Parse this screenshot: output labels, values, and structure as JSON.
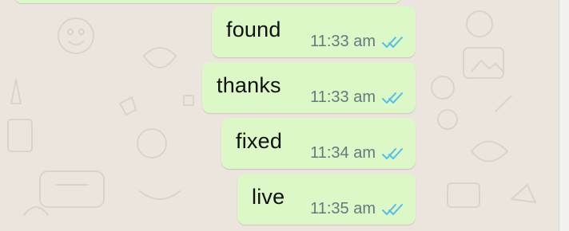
{
  "colors": {
    "wallpaper": "#ece5dd",
    "bubble_outgoing": "#dcf8c6",
    "read_ticks": "#53bdeb",
    "timestamp": "#667781"
  },
  "messages": [
    {
      "text": "found",
      "time": "11:33 am",
      "status": "read",
      "status_icon": "double-check-icon"
    },
    {
      "text": "thanks",
      "time": "11:33 am",
      "status": "read",
      "status_icon": "double-check-icon"
    },
    {
      "text": "fixed",
      "time": "11:34 am",
      "status": "read",
      "status_icon": "double-check-icon"
    },
    {
      "text": "live",
      "time": "11:35 am",
      "status": "read",
      "status_icon": "double-check-icon"
    }
  ]
}
